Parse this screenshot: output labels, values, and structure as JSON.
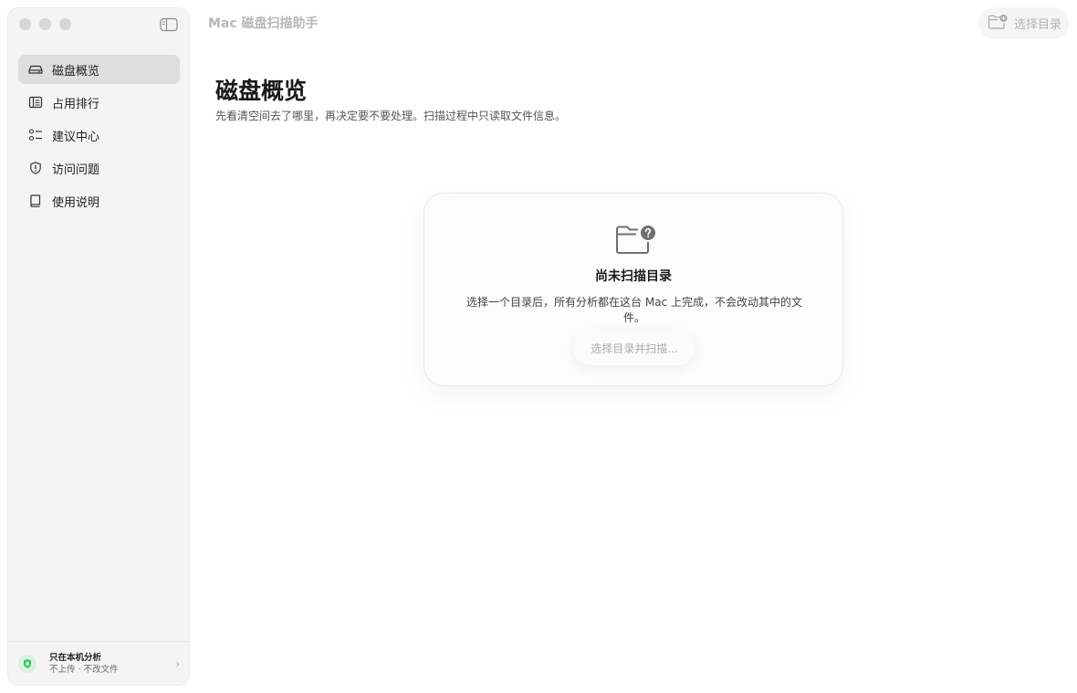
{
  "app": {
    "title": "Mac 磁盘扫描助手"
  },
  "toolbar": {
    "select_dir_label": "选择目录"
  },
  "sidebar": {
    "items": [
      {
        "label": "磁盘概览",
        "icon": "drive-icon",
        "active": true
      },
      {
        "label": "占用排行",
        "icon": "list-icon",
        "active": false
      },
      {
        "label": "建议中心",
        "icon": "checklist-icon",
        "active": false
      },
      {
        "label": "访问问题",
        "icon": "shield-alert-icon",
        "active": false
      },
      {
        "label": "使用说明",
        "icon": "book-icon",
        "active": false
      }
    ],
    "footer": {
      "title": "只在本机分析",
      "subtitle": "不上传 · 不改文件",
      "icon": "shield-check-icon"
    }
  },
  "main": {
    "title": "磁盘概览",
    "subtitle": "先看清空间去了哪里，再决定要不要处理。扫描过程中只读取文件信息。",
    "empty_state": {
      "icon": "folder-question-icon",
      "title": "尚未扫描目录",
      "description": "选择一个目录后，所有分析都在这台 Mac 上完成，不会改动其中的文件。",
      "button_label": "选择目录并扫描..."
    }
  },
  "colors": {
    "accent_green": "#34c759",
    "active_bg": "#dedede",
    "sidebar_bg": "#f4f4f4"
  }
}
